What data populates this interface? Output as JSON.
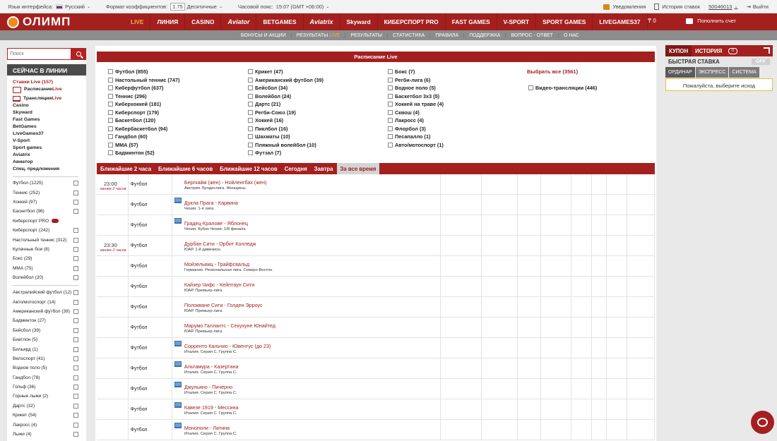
{
  "topbar": {
    "lang_label": "Язык интерфейса:",
    "lang_value": "Русский",
    "coef_label": "Формат коэффициентов:",
    "coef_value": "1.75",
    "coef_type": "Десятичные",
    "tz_label": "Часовой пояс:",
    "tz_value": "15:07 (GMT +06:00)",
    "notifications": "Уведомления",
    "history": "История ставок",
    "account": "50046013",
    "logout": "Выйти"
  },
  "nav": {
    "logo": "ОЛИМП",
    "items": [
      "LIVE",
      "ЛИНИЯ",
      "CASINO",
      "Aviator",
      "BETGAMES",
      "Aviatrix",
      "Skyward",
      "КИБЕРСПОРТ PRO",
      "FAST GAMES",
      "V-SPORT",
      "SPORT GAMES",
      "LIVEGAMES37"
    ],
    "balance": "₸ 0",
    "topup": "Пополнить счет"
  },
  "subnav": {
    "items": [
      "БОНУСЫ И АКЦИИ",
      "РЕЗУЛЬТАТЫ",
      "РЕЗУЛЬТАТЫ",
      "СТАТИСТИКА",
      "ПРАВИЛА",
      "ПОДДЕРЖКА",
      "ВОПРОС - ОТВЕТ",
      "О НАС"
    ],
    "results_live": "LIVE"
  },
  "left": {
    "search_placeholder": "Поиск",
    "header": "СЕЙЧАС В ЛИНИИ",
    "live_bets": "Ставки Live (157)",
    "schedule_pre": "Расписание ",
    "schedule_live": "Live",
    "streams_pre": "Трансляции ",
    "streams_live": "Live",
    "links": [
      "Casino",
      "Skyward",
      "Fast Games",
      "BetGames",
      "LiveGames37",
      "V-Sport",
      "Sport games",
      "Aviatrix",
      "Авиатор",
      "Спец. предложения"
    ],
    "group1": [
      "Футбол (1225)",
      "Теннис (252)",
      "Хоккей (97)",
      "Баскетбол (96)",
      "Киберспорт PRO",
      "Киберспорт (242)",
      "Настольный теннис (312)",
      "Кулачные бои (8)",
      "Бокс (29)",
      "ММА (75)",
      "Волейбол (20)"
    ],
    "group2": [
      "Австралийский футбол (12)",
      "Авто/мотоспорт (14)",
      "Американский футбол (39)",
      "Бадминтон (27)",
      "Бейсбол (39)",
      "Биатлон (5)",
      "Бильярд (1)",
      "Велоспорт (41)",
      "Водное поло (5)",
      "Гандбол (78)",
      "Гольф (36)",
      "Горные лыжи (2)",
      "Дартс (32)",
      "Крикет (54)",
      "Лакросс (4)",
      "Лыжи (4)"
    ]
  },
  "schedule": {
    "title": "Расписание Live",
    "col1": [
      "Футбол (855)",
      "Настольный теннис (747)",
      "Киберфутбол (637)",
      "Теннис (296)",
      "Киберхоккей (181)",
      "Киберспорт (179)",
      "Баскетбол (120)",
      "Кибербаскетбол (94)",
      "Гандбол (60)",
      "ММА (57)",
      "Бадминтон (52)"
    ],
    "col2": [
      "Крикет (47)",
      "Американский футбол (39)",
      "Бейсбол (34)",
      "Волейбол (24)",
      "Дартс (21)",
      "Регби-Союз (19)",
      "Хоккей (16)",
      "Пиклбол (16)",
      "Шахматы (10)",
      "Пляжный волейбол (10)",
      "Футзал (7)"
    ],
    "col3": [
      "Бокс (7)",
      "Регби-лига (6)",
      "Водное поло (5)",
      "Баскетбол 3х3 (5)",
      "Хоккей на траве (4)",
      "Сквош (4)",
      "Лакросс (4)",
      "Флорбол (3)",
      "Песапалло (1)",
      "Авто/мотоспорт (1)"
    ],
    "select_all": "Выбрать все (3561)",
    "video": "Видео-трансляции (446)",
    "tabs": [
      "Ближайшие 2 часа",
      "Ближайшие 6 часов",
      "Ближайшие 12 часов",
      "Сегодня",
      "Завтра",
      "За все время"
    ]
  },
  "events": [
    {
      "time": "23:00",
      "sub": "менее 2 часов",
      "sport": "Футбол",
      "match": "Бергкайм (жен) - Нойленгбах (жен)",
      "league": "Австрия. Бундеслига. Женщины.",
      "tv": false
    },
    {
      "time": "",
      "sub": "",
      "sport": "Футбол",
      "match": "Дукла Прага - Карвина",
      "league": "Чехия. 1-я лига.",
      "tv": true
    },
    {
      "time": "",
      "sub": "",
      "sport": "Футбол",
      "match": "Градец-Кралове - Яблонец",
      "league": "Чехия. Кубок Чехии. 1/8 финала.",
      "tv": true
    },
    {
      "time": "23:30",
      "sub": "менее 2 часов",
      "sport": "Футбол",
      "match": "Дурбан Сити - Орбит Колледж",
      "league": "ЮАР. 1-й дивизион.",
      "tv": false
    },
    {
      "time": "",
      "sub": "",
      "sport": "Футбол",
      "match": "Мойзельвиц - Грайфсвальд",
      "league": "Германия. Региональная лига. Северо-Восток.",
      "tv": false
    },
    {
      "time": "",
      "sub": "",
      "sport": "Футбол",
      "match": "Кайзер Чифс - Кейптаун Сити",
      "league": "ЮАР. Премьер-лига.",
      "tv": false
    },
    {
      "time": "",
      "sub": "",
      "sport": "Футбол",
      "match": "Полокване Сити - Голден Эрроус",
      "league": "ЮАР. Премьер-лига.",
      "tv": false
    },
    {
      "time": "",
      "sub": "",
      "sport": "Футбол",
      "match": "Марумо Галлантс - Секухуне Юнайтед",
      "league": "ЮАР. Премьер-лига.",
      "tv": false
    },
    {
      "time": "",
      "sub": "",
      "sport": "Футбол",
      "match": "Сорренто Кальчио - Ювентус (до 23)",
      "league": "Италия. Серия С. Группа С.",
      "tv": true
    },
    {
      "time": "",
      "sub": "",
      "sport": "Футбол",
      "match": "Альтамура - Казертана",
      "league": "Италия. Серия С. Группа С.",
      "tv": true
    },
    {
      "time": "",
      "sub": "",
      "sport": "Футбол",
      "match": "Джульяно - Пичерно",
      "league": "Италия. Серия С. Группа С.",
      "tv": true
    },
    {
      "time": "",
      "sub": "",
      "sport": "Футбол",
      "match": "Кавезе 1919 - Мессина",
      "league": "Италия. Серия С. Группа С.",
      "tv": true
    },
    {
      "time": "",
      "sub": "",
      "sport": "Футбол",
      "match": "Монополи - Латина",
      "league": "Италия. Серия С. Группа С.",
      "tv": true
    }
  ],
  "coupon": {
    "tab1": "КУПОН",
    "tab2": "ИСТОРИЯ",
    "counter": "0",
    "quick": "БЫСТРАЯ СТАВКА",
    "quick_state": "OFF",
    "types": [
      "ОРДИНАР",
      "ЭКСПРЕСС",
      "СИСТЕМА"
    ],
    "choose": "Пожалуйста, выберите исход"
  }
}
